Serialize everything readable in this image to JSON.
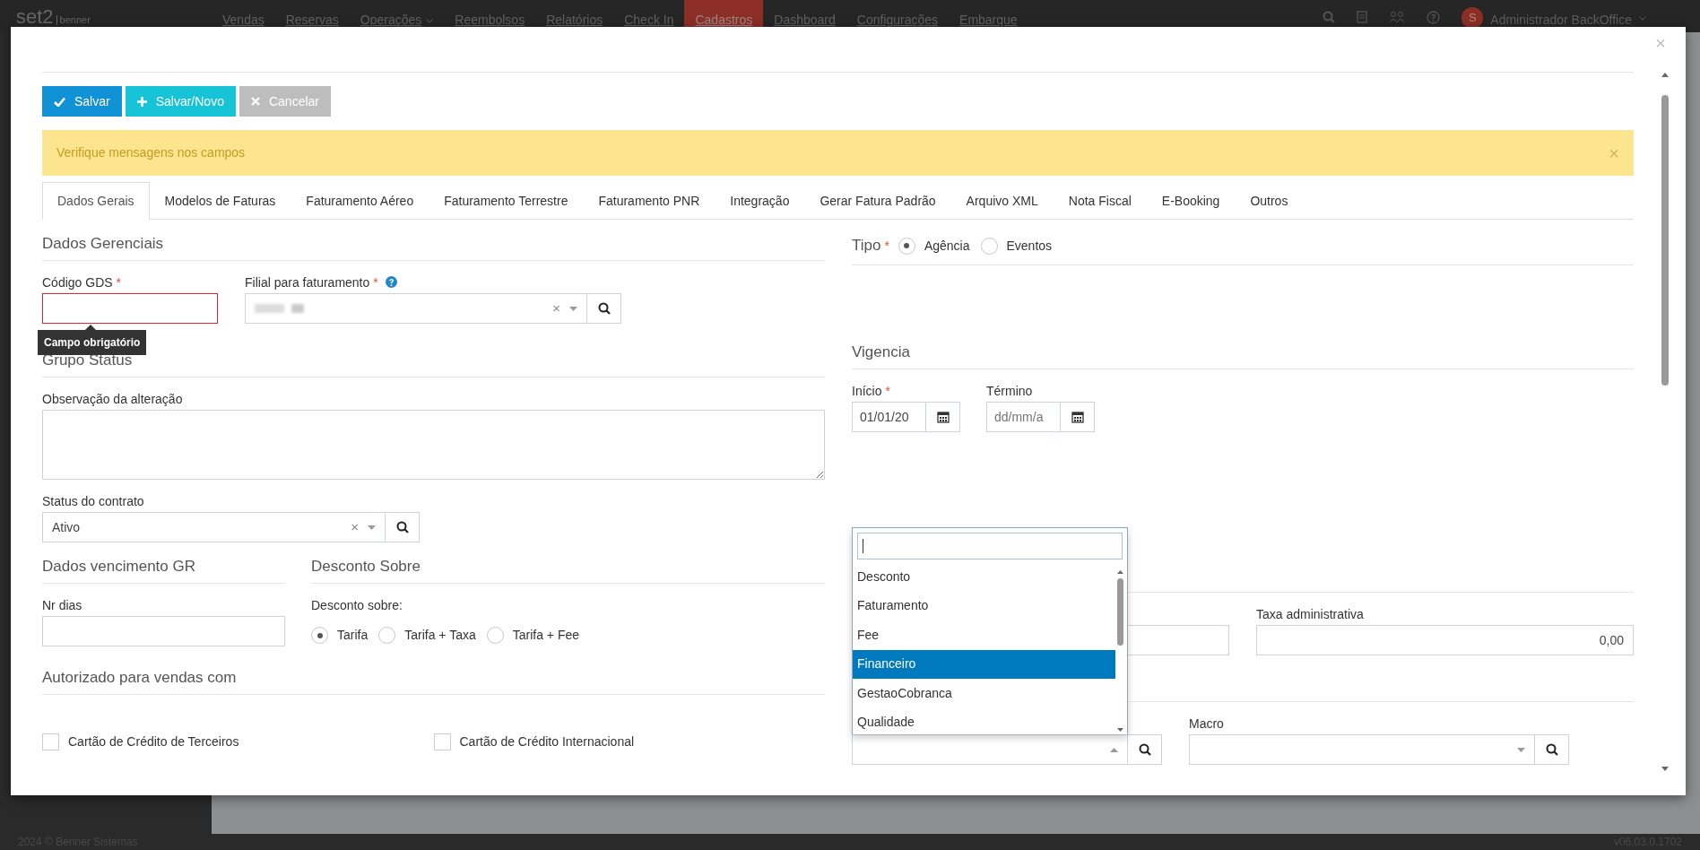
{
  "navbar": {
    "logo": "set2",
    "logo_sub": "benner",
    "items": [
      {
        "label": "Vendas",
        "selected": false,
        "dropdown": false
      },
      {
        "label": "Reservas",
        "selected": false,
        "dropdown": false
      },
      {
        "label": "Operações",
        "selected": false,
        "dropdown": true
      },
      {
        "label": "Reembolsos",
        "selected": false,
        "dropdown": false
      },
      {
        "label": "Relatórios",
        "selected": false,
        "dropdown": false
      },
      {
        "label": "Check In",
        "selected": false,
        "dropdown": false
      },
      {
        "label": "Cadastros",
        "selected": true,
        "dropdown": false
      },
      {
        "label": "Dashboard",
        "selected": false,
        "dropdown": false
      },
      {
        "label": "Configurações",
        "selected": false,
        "dropdown": false
      },
      {
        "label": "Embarque",
        "selected": false,
        "dropdown": false
      }
    ],
    "user": {
      "avatar": "S",
      "name": "Administrador BackOffice"
    }
  },
  "modal": {
    "close": "×",
    "required_mark": "*",
    "buttons": [
      {
        "label": "Salvar",
        "kind": "save"
      },
      {
        "label": "Salvar/Novo",
        "kind": "new"
      },
      {
        "label": "Cancelar",
        "kind": "cancel"
      }
    ],
    "alert": {
      "text": "Verifique mensagens nos campos",
      "close": "×"
    },
    "tabs": [
      {
        "label": "Dados Gerais",
        "selected": true
      },
      {
        "label": "Modelos de Faturas",
        "selected": false
      },
      {
        "label": "Faturamento Aéreo",
        "selected": false
      },
      {
        "label": "Faturamento Terrestre",
        "selected": false
      },
      {
        "label": "Faturamento PNR",
        "selected": false
      },
      {
        "label": "Integração",
        "selected": false
      },
      {
        "label": "Gerar Fatura Padrão",
        "selected": false
      },
      {
        "label": "Arquivo XML",
        "selected": false
      },
      {
        "label": "Nota Fiscal",
        "selected": false
      },
      {
        "label": "E-Booking",
        "selected": false
      },
      {
        "label": "Outros",
        "selected": false
      }
    ],
    "dados_gerenciais": {
      "title": "Dados Gerenciais",
      "codigo_gds": {
        "label": "Código GDS",
        "required": true,
        "invalid": true,
        "tooltip": "Campo obrigatório"
      },
      "filial": {
        "label": "Filial para faturamento",
        "required": true,
        "clear": "×"
      }
    },
    "grupo_status": {
      "title": "Grupo Status",
      "observacao": {
        "label": "Observação da alteração"
      },
      "status": {
        "label": "Status do contrato",
        "value": "Ativo",
        "clear": "×"
      }
    },
    "vencimento": {
      "title": "Dados vencimento GR",
      "nr_dias": {
        "label": "Nr dias"
      }
    },
    "desconto": {
      "title": "Desconto Sobre",
      "label": "Desconto sobre:",
      "options": [
        {
          "label": "Tarifa",
          "selected": true
        },
        {
          "label": "Tarifa + Taxa",
          "selected": false
        },
        {
          "label": "Tarifa + Fee",
          "selected": false
        }
      ]
    },
    "autorizado": {
      "title": "Autorizado para vendas com",
      "options": [
        {
          "label": "Cartão de Crédito de Terceiros",
          "checked": false
        },
        {
          "label": "Cartão de Crédito Internacional",
          "checked": false
        }
      ]
    },
    "tipo": {
      "title": "Tipo",
      "required": true,
      "options": [
        {
          "label": "Agência",
          "selected": true
        },
        {
          "label": "Eventos",
          "selected": false
        }
      ]
    },
    "vigencia": {
      "title": "Vigencia",
      "inicio": {
        "label": "Início",
        "required": true,
        "value": "01/01/20"
      },
      "termino": {
        "label": "Término",
        "required": false,
        "placeholder": "dd/mm/a"
      }
    },
    "taxa": {
      "label": "Taxa administrativa",
      "value": "0,00"
    },
    "macro": {
      "label": "Macro"
    },
    "dropdown": {
      "open": true,
      "options": [
        {
          "label": "Desconto",
          "selected": false
        },
        {
          "label": "Faturamento",
          "selected": false
        },
        {
          "label": "Fee",
          "selected": false
        },
        {
          "label": "Financeiro",
          "selected": true
        },
        {
          "label": "GestaoCobranca",
          "selected": false
        },
        {
          "label": "Qualidade",
          "selected": false
        }
      ]
    }
  },
  "footer": {
    "copyright": "2024 © Benner Sistemas",
    "version": "v06.03.0.1702"
  }
}
